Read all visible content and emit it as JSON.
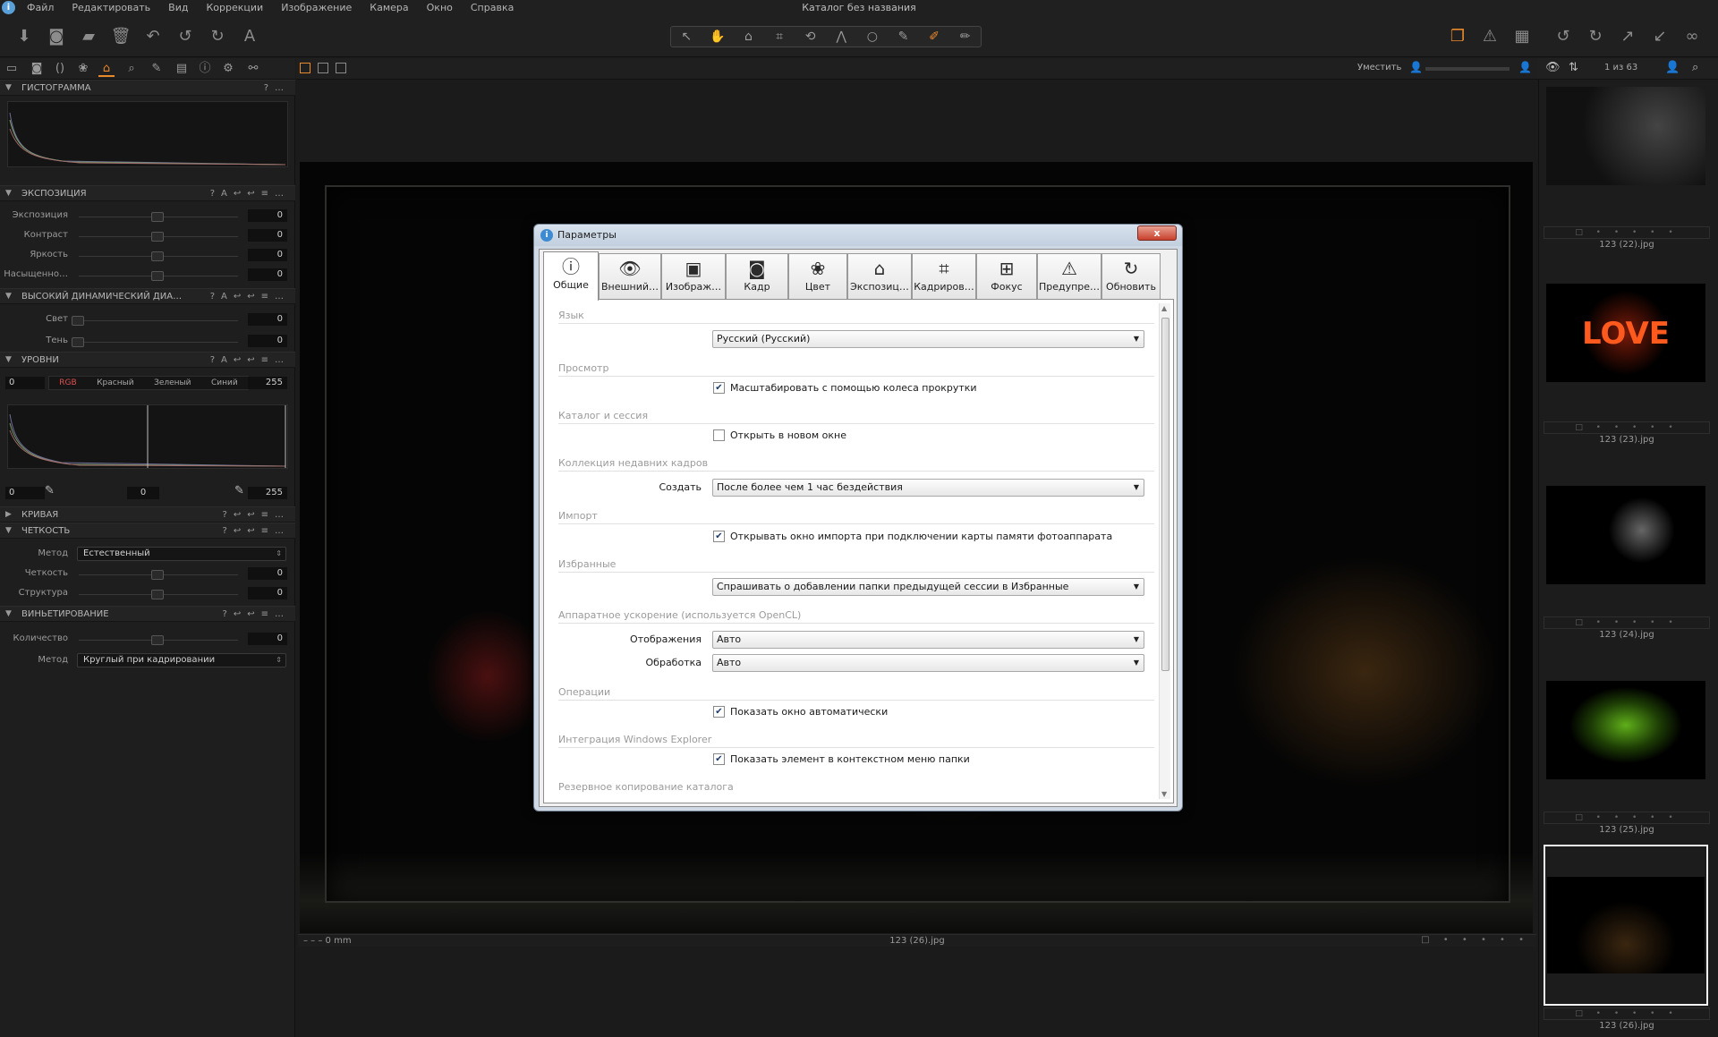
{
  "window": {
    "title": "Каталог без названия"
  },
  "menu": [
    "Файл",
    "Редактировать",
    "Вид",
    "Коррекции",
    "Изображение",
    "Камера",
    "Окно",
    "Справка"
  ],
  "viewer_bar": {
    "fit_label": "Уместить",
    "count": "1 из 63"
  },
  "histogram": {
    "title": "ГИСТОГРАММА",
    "help": "?",
    "more": "…"
  },
  "exposure": {
    "title": "ЭКСПОЗИЦИЯ",
    "rows": [
      {
        "label": "Экспозиция",
        "value": "0"
      },
      {
        "label": "Контраст",
        "value": "0"
      },
      {
        "label": "Яркость",
        "value": "0"
      },
      {
        "label": "Насыщенно…",
        "value": "0"
      }
    ]
  },
  "hdr": {
    "title": "ВЫСОКИЙ ДИНАМИЧЕСКИЙ ДИА…",
    "rows": [
      {
        "label": "Свет",
        "value": "0"
      },
      {
        "label": "Тень",
        "value": "0"
      }
    ]
  },
  "levels": {
    "title": "УРОВНИ",
    "in_low": "0",
    "in_high": "255",
    "channels": [
      "RGB",
      "Красный",
      "Зеленый",
      "Синий"
    ],
    "out_low": "0",
    "mid": "0",
    "out_high": "255"
  },
  "curve": {
    "title": "КРИВАЯ"
  },
  "clarity": {
    "title": "ЧЕТКОСТЬ",
    "method_label": "Метод",
    "method_value": "Естественный",
    "rows": [
      {
        "label": "Четкость",
        "value": "0"
      },
      {
        "label": "Структура",
        "value": "0"
      }
    ]
  },
  "vignette": {
    "title": "ВИНЬЕТИРОВАНИЕ",
    "amount_label": "Количество",
    "amount_value": "0",
    "method_label": "Метод",
    "method_value": "Круглый при кадрировании"
  },
  "statusbar": {
    "left": "– – – 0 mm",
    "filename": "123 (26).jpg"
  },
  "thumbnails": [
    {
      "name": "123 (22).jpg"
    },
    {
      "name": "123 (23).jpg"
    },
    {
      "name": "123 (24).jpg"
    },
    {
      "name": "123 (25).jpg"
    },
    {
      "name": "123 (26).jpg"
    }
  ],
  "dialog": {
    "title": "Параметры",
    "close": "x",
    "tabs": [
      {
        "label": "Общие",
        "icon": "info-circle-icon",
        "glyph": "ⓘ"
      },
      {
        "label": "Внешний…",
        "icon": "eye-icon",
        "glyph": "👁"
      },
      {
        "label": "Изображ…",
        "icon": "image-icon",
        "glyph": "▣"
      },
      {
        "label": "Кадр",
        "icon": "camera-icon",
        "glyph": "◙"
      },
      {
        "label": "Цвет",
        "icon": "color-circles-icon",
        "glyph": "❀"
      },
      {
        "label": "Экспозиц…",
        "icon": "exposure-icon",
        "glyph": "⌂"
      },
      {
        "label": "Кадриров…",
        "icon": "crop-icon",
        "glyph": "⌗"
      },
      {
        "label": "Фокус",
        "icon": "focus-icon",
        "glyph": "⊞"
      },
      {
        "label": "Предупре…",
        "icon": "warning-icon",
        "glyph": "⚠"
      },
      {
        "label": "Обновить",
        "icon": "update-icon",
        "glyph": "↻"
      }
    ],
    "sections": {
      "language": {
        "title": "Язык",
        "value": "Русский (Русский)"
      },
      "view": {
        "title": "Просмотр",
        "check": "Масштабировать с помощью колеса прокрутки"
      },
      "catalog": {
        "title": "Каталог и сессия",
        "check": "Открыть в новом окне"
      },
      "recent": {
        "title": "Коллекция недавних кадров",
        "label": "Создать",
        "value": "После более чем 1 час бездействия"
      },
      "import": {
        "title": "Импорт",
        "check": "Открывать окно импорта при подключении карты памяти фотоаппарата"
      },
      "favorites": {
        "title": "Избранные",
        "value": "Спрашивать о добавлении папки предыдущей сессии в Избранные"
      },
      "hardware": {
        "title": "Аппаратное ускорение (используется OpenCL)",
        "display_label": "Отображения",
        "display_value": "Авто",
        "process_label": "Обработка",
        "process_value": "Авто"
      },
      "operations": {
        "title": "Операции",
        "check": "Показать окно автоматически"
      },
      "explorer": {
        "title": "Интеграция Windows Explorer",
        "check": "Показать элемент в контекстном меню папки"
      },
      "backup": {
        "title": "Резервное копирование каталога"
      }
    },
    "checks": {
      "view": true,
      "catalog": false,
      "import": true,
      "operations": true,
      "explorer": true
    }
  },
  "colors": {
    "accent": "#e8892c",
    "panel": "#1e1e1e",
    "dialog_bg": "#f0f0f0"
  }
}
